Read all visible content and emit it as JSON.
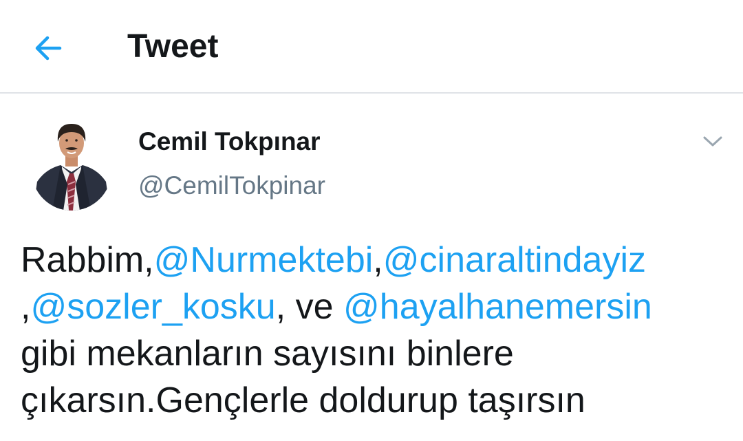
{
  "header": {
    "title": "Tweet",
    "back_icon": "arrow-left-icon"
  },
  "author": {
    "name": "Cemil Tokpınar",
    "handle": "@CemilTokpinar",
    "avatar_icon": "avatar-photo"
  },
  "menu": {
    "caret_icon": "chevron-down-icon"
  },
  "tweet": {
    "line1": {
      "t1": "Rabbim,",
      "m1": "@Nurmektebi",
      "t2": ",",
      "m2": "@cinaraltindayiz"
    },
    "line2": {
      "t1": ",",
      "m1": "@sozler_kosku",
      "t2": ", ve ",
      "m2": "@hayalhanemersin"
    },
    "line3": "gibi mekanların sayısını binlere",
    "line4": "çıkarsın.Gençlerle doldurup taşırsın"
  },
  "colors": {
    "accent": "#1da1f2",
    "text": "#14171a",
    "secondary": "#657786",
    "divider": "#dfe3e7"
  }
}
